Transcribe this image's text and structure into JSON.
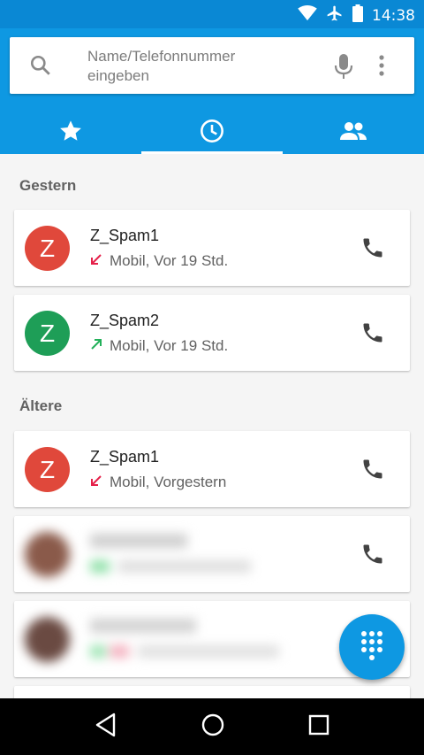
{
  "status_bar": {
    "time": "14:38",
    "icons": [
      "wifi-icon",
      "airplane-mode-icon",
      "battery-icon"
    ]
  },
  "search": {
    "placeholder": "Name/Telefonnummer eingeben"
  },
  "tabs": [
    {
      "icon": "star-icon",
      "label": "Favoriten"
    },
    {
      "icon": "clock-icon",
      "label": "Anrufliste",
      "active": true
    },
    {
      "icon": "contacts-icon",
      "label": "Kontakte"
    }
  ],
  "sections": [
    {
      "title": "Gestern",
      "calls": [
        {
          "initial": "Z",
          "name": "Z_Spam1",
          "detail": "Mobil, Vor 19 Std.",
          "direction": "missed",
          "avatar_color": "#e0483b"
        },
        {
          "initial": "Z",
          "name": "Z_Spam2",
          "detail": "Mobil, Vor 19 Std.",
          "direction": "outgoing",
          "avatar_color": "#1e9e57"
        }
      ]
    },
    {
      "title": "Ältere",
      "calls": [
        {
          "initial": "Z",
          "name": "Z_Spam1",
          "detail": "Mobil, Vorgestern",
          "direction": "missed",
          "avatar_color": "#e0483b"
        }
      ]
    }
  ],
  "colors": {
    "primary": "#0e98e2",
    "primary_dark": "#0a88d4",
    "missed": "#e5214a",
    "outgoing": "#23b05a"
  }
}
